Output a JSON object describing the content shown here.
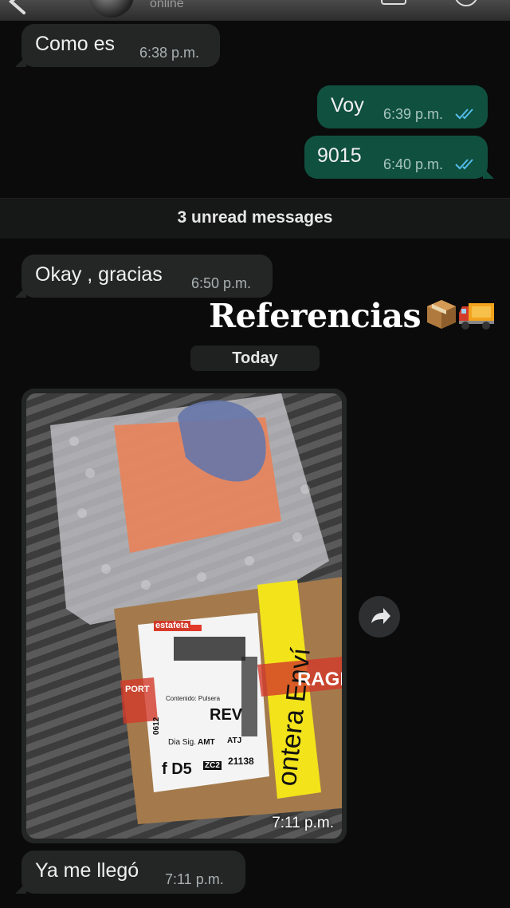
{
  "header": {
    "status": "online"
  },
  "messages": [
    {
      "text": "Como es",
      "time": "6:38 p.m."
    },
    {
      "text": "Voy",
      "time": "6:39 p.m."
    },
    {
      "text": "9015",
      "time": "6:40 p.m."
    }
  ],
  "unread_banner": "3 unread messages",
  "messages_after": [
    {
      "text": "Okay , gracias",
      "time": "6:50 p.m."
    }
  ],
  "overlay": {
    "title": "Referencias",
    "emojis": [
      "package-emoji",
      "truck-emoji"
    ]
  },
  "date_divider": "Today",
  "photo_message": {
    "time": "7:11 p.m.",
    "label_texts": [
      "estafeta",
      "REV",
      "f D5",
      "21138",
      "ZC2",
      "AMT",
      "ATJ",
      "Dia Sig.",
      "0612",
      "Contenido: Pulsera",
      "ontera Enví",
      "RAGIL",
      "PORT"
    ]
  },
  "last_message": {
    "text": "Ya me llegó",
    "time": "7:11 p.m."
  },
  "colors": {
    "background": "#0b0b0b",
    "incoming_bubble": "#242626",
    "outgoing_bubble": "#10503f",
    "read_ticks": "#53bdeb"
  }
}
